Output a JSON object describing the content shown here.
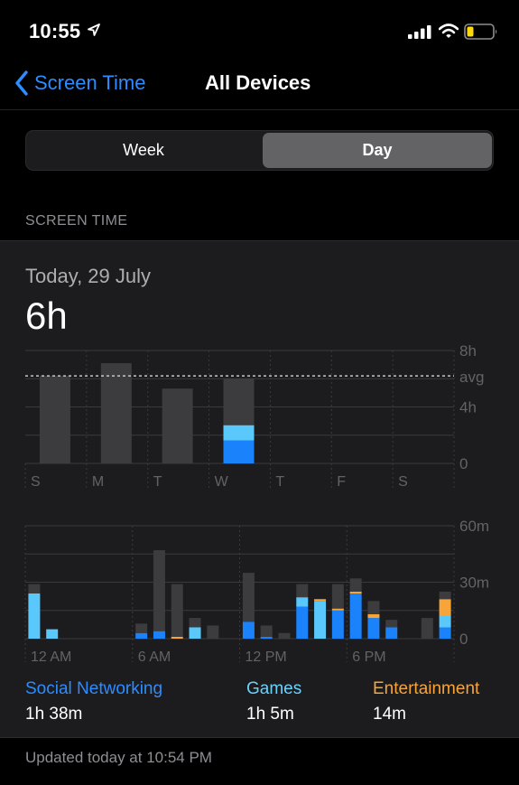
{
  "status": {
    "time": "10:55"
  },
  "nav": {
    "back_label": "Screen Time",
    "title": "All Devices"
  },
  "segmented": {
    "week_label": "Week",
    "day_label": "Day",
    "selected": "Day"
  },
  "section": {
    "header": "SCREEN TIME"
  },
  "summary": {
    "date": "Today, 29 July",
    "total": "6h"
  },
  "colors": {
    "social": "#1a82fb",
    "games": "#5ac8fa",
    "entertainment": "#f7a438",
    "other": "#3c3c3e"
  },
  "chart_data": [
    {
      "type": "bar",
      "categories": [
        "S",
        "M",
        "T",
        "W",
        "T",
        "F",
        "S"
      ],
      "series": [
        {
          "name": "Social Networking",
          "values": [
            0,
            0,
            0,
            1.63,
            0,
            0,
            0
          ]
        },
        {
          "name": "Games",
          "values": [
            0,
            0,
            0,
            1.08,
            0,
            0,
            0
          ]
        },
        {
          "name": "Entertainment",
          "values": [
            0,
            0,
            0,
            0,
            0,
            0,
            0
          ]
        },
        {
          "name": "",
          "values": [
            6.2,
            7.1,
            5.3,
            3.3,
            0,
            0,
            0
          ]
        }
      ],
      "ylim": [
        0,
        8
      ],
      "ytick_labels": [
        "8h",
        "avg",
        "4h",
        "0"
      ],
      "average": 6.2
    },
    {
      "type": "bar",
      "categories": [
        "12 AM",
        "1",
        "2",
        "3",
        "4",
        "5",
        "6 AM",
        "7",
        "8",
        "9",
        "10",
        "11",
        "12 PM",
        "13",
        "14",
        "15",
        "16",
        "17",
        "6 PM",
        "19",
        "20",
        "21",
        "22",
        "23"
      ],
      "x_labels": [
        "12 AM",
        "6 AM",
        "12 PM",
        "6 PM"
      ],
      "series": [
        {
          "name": "Social Networking",
          "values": [
            0,
            0,
            0,
            0,
            0,
            0,
            3,
            4,
            0,
            0,
            0,
            0,
            9,
            1,
            0,
            17,
            0,
            15,
            24,
            11,
            6,
            0,
            0,
            6
          ]
        },
        {
          "name": "Games",
          "values": [
            24,
            5,
            0,
            0,
            0,
            0,
            0,
            0,
            0,
            6,
            0,
            0,
            0,
            0,
            0,
            5,
            20,
            0,
            0,
            0,
            0,
            0,
            0,
            6
          ]
        },
        {
          "name": "Entertainment",
          "values": [
            0,
            0,
            0,
            0,
            0,
            0,
            0,
            0,
            1,
            0,
            0,
            0,
            0,
            0,
            0,
            0,
            1,
            1,
            1,
            2,
            0,
            0,
            0,
            9
          ]
        },
        {
          "name": "",
          "values": [
            5,
            0,
            0,
            0,
            0,
            0,
            5,
            43,
            28,
            5,
            7,
            0,
            26,
            6,
            3,
            7,
            0,
            13,
            7,
            7,
            4,
            0,
            11,
            4
          ]
        }
      ],
      "ylim": [
        0,
        60
      ],
      "ytick_labels": [
        "60m",
        "30m",
        "0"
      ]
    }
  ],
  "legend": [
    {
      "label": "Social Networking",
      "value": "1h 38m",
      "color": "#2d8cff"
    },
    {
      "label": "Games",
      "value": "1h 5m",
      "color": "#6ad1fb"
    },
    {
      "label": "Entertainment",
      "value": "14m",
      "color": "#f7a438"
    }
  ],
  "footer": {
    "updated": "Updated today at 10:54 PM"
  }
}
